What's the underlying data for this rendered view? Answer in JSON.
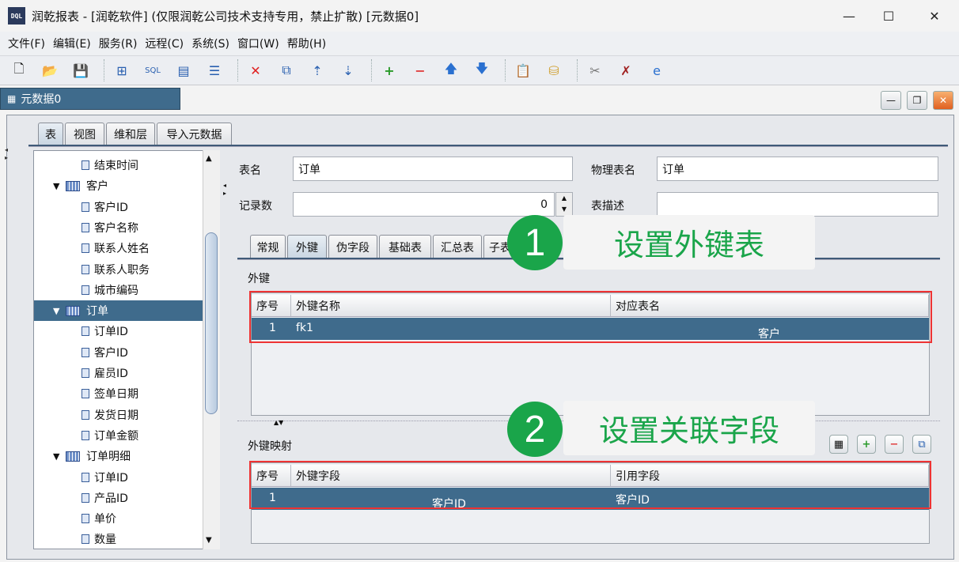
{
  "window": {
    "logo": "DQL",
    "title": "润乾报表 - [润乾软件] (仅限润乾公司技术支持专用，禁止扩散)  [元数据0]",
    "minimize": "—",
    "maximize": "☐",
    "close": "✕"
  },
  "menu": [
    "文件(F)",
    "编辑(E)",
    "服务(R)",
    "远程(C)",
    "系统(S)",
    "窗口(W)",
    "帮助(H)"
  ],
  "doc_tab": "元数据0",
  "main_tabs": [
    "表",
    "视图",
    "维和层",
    "导入元数据"
  ],
  "tree": [
    {
      "label": "结束时间",
      "level": 2
    },
    {
      "label": "客户",
      "level": 1
    },
    {
      "label": "客户ID",
      "level": 2
    },
    {
      "label": "客户名称",
      "level": 2
    },
    {
      "label": "联系人姓名",
      "level": 2
    },
    {
      "label": "联系人职务",
      "level": 2
    },
    {
      "label": "城市编码",
      "level": 2
    },
    {
      "label": "订单",
      "level": 1,
      "selected": true
    },
    {
      "label": "订单ID",
      "level": 2
    },
    {
      "label": "客户ID",
      "level": 2
    },
    {
      "label": "雇员ID",
      "level": 2
    },
    {
      "label": "签单日期",
      "level": 2
    },
    {
      "label": "发货日期",
      "level": 2
    },
    {
      "label": "订单金额",
      "level": 2
    },
    {
      "label": "订单明细",
      "level": 1
    },
    {
      "label": "订单ID",
      "level": 2
    },
    {
      "label": "产品ID",
      "level": 2
    },
    {
      "label": "单价",
      "level": 2
    },
    {
      "label": "数量",
      "level": 2
    }
  ],
  "form": {
    "table_name_label": "表名",
    "table_name": "订单",
    "physical_label": "物理表名",
    "physical_name": "订单",
    "count_label": "记录数",
    "count": "0",
    "desc_label": "表描述",
    "desc": ""
  },
  "sub_tabs": [
    "常规",
    "外键",
    "伪字段",
    "基础表",
    "汇总表",
    "子表"
  ],
  "fk": {
    "title": "外键",
    "headers": [
      "序号",
      "外键名称",
      "对应表名"
    ],
    "rows": [
      [
        "1",
        "fk1",
        "客户"
      ]
    ]
  },
  "mapping": {
    "title": "外键映射",
    "headers": [
      "序号",
      "外键字段",
      "引用字段"
    ],
    "rows": [
      [
        "1",
        "客户ID",
        "客户ID"
      ]
    ]
  },
  "callouts": [
    {
      "num": "1",
      "text": "设置外键表"
    },
    {
      "num": "2",
      "text": "设置关联字段"
    }
  ],
  "colors": {
    "selection": "#3f6b8c",
    "callout": "#1aa54a",
    "highlight": "#ee3333"
  }
}
